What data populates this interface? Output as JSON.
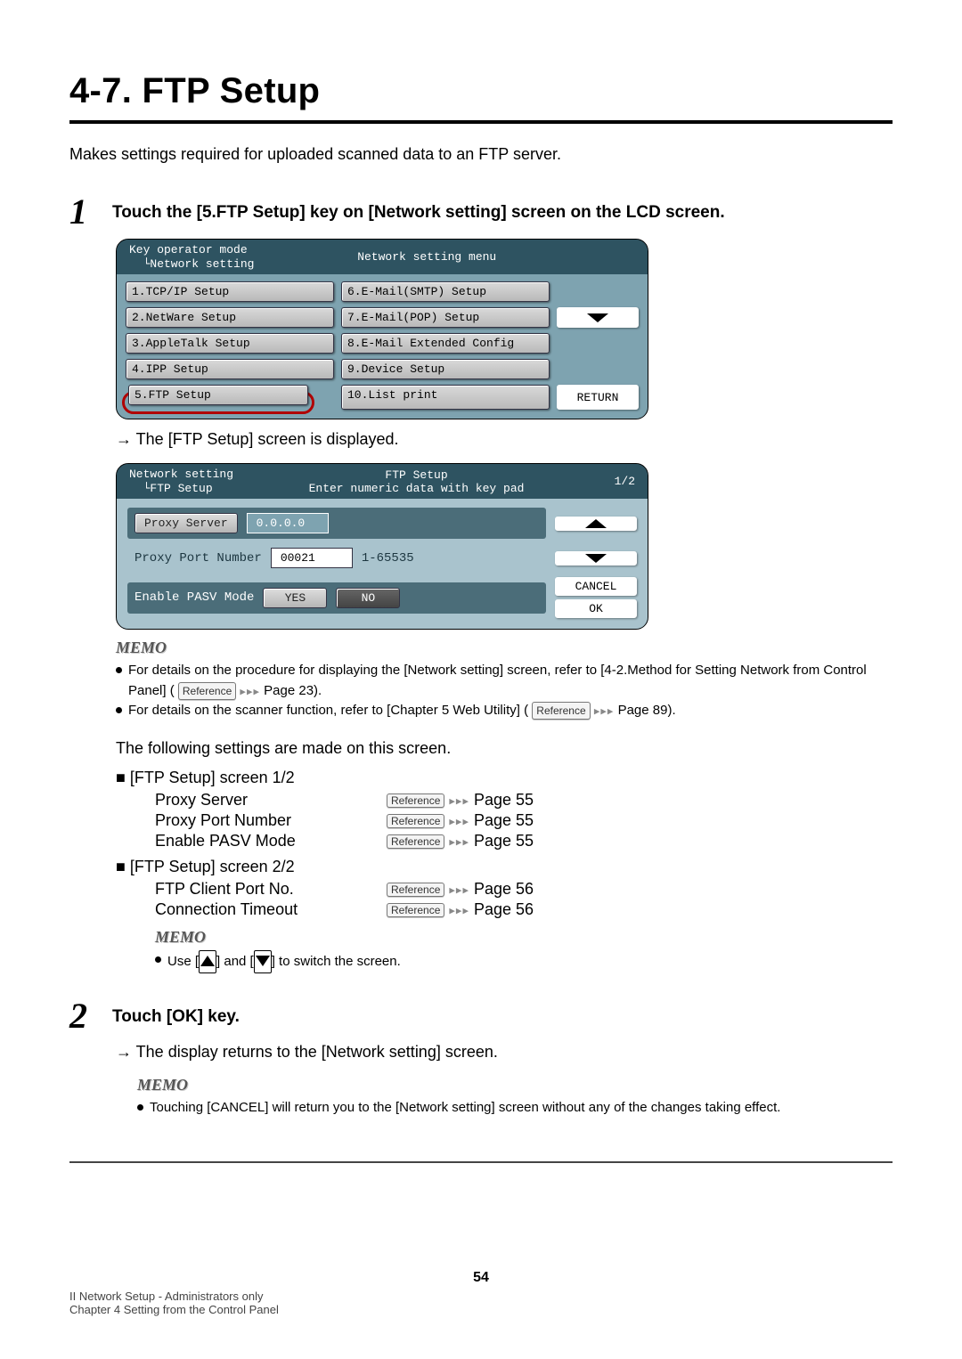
{
  "title": "4-7. FTP Setup",
  "intro": "Makes settings required for uploaded scanned data to an FTP server.",
  "step1_title": "Touch the [5.FTP Setup] key on [Network setting] screen on the LCD screen.",
  "arrow1": "→ The [FTP Setup] screen is displayed.",
  "lcd1": {
    "top_left": "Key operator mode\n  └Network setting",
    "top_center": "Network setting menu",
    "items_left": [
      "1.TCP/IP Setup",
      "2.NetWare Setup",
      "3.AppleTalk Setup",
      "4.IPP Setup",
      "5.FTP Setup"
    ],
    "items_right": [
      "6.E-Mail(SMTP) Setup",
      "7.E-Mail(POP) Setup",
      "8.E-Mail Extended Config",
      "9.Device Setup",
      "10.List print"
    ],
    "return": "RETURN"
  },
  "lcd2": {
    "top_left": "Network setting\n  └FTP Setup",
    "top_center": "FTP Setup\nEnter numeric data with key pad",
    "page": "1/2",
    "proxy_server_label": "Proxy Server",
    "proxy_server_value": "0.0.0.0",
    "proxy_port_label": "Proxy Port Number",
    "proxy_port_value": "00021",
    "proxy_port_hint": "1-65535",
    "pasv_label": "Enable PASV Mode",
    "yes": "YES",
    "no": "NO",
    "cancel": "CANCEL",
    "ok": "OK"
  },
  "memo": "MEMO",
  "memo1_lines": [
    "For details on the procedure for displaying the [Network setting] screen, refer to [4-2.Method for Setting Network from Control Panel] ( ",
    " Page 23).",
    "For details on the scanner function, refer to [Chapter 5 Web Utility] ( ",
    " Page 89)."
  ],
  "ref_label": "Reference",
  "ref_dots": "▸▸▸",
  "following": "The following settings are made on this screen.",
  "sec1_head": "[FTP Setup] screen 1/2",
  "sec1_rows": [
    {
      "name": "Proxy Server",
      "page": "Page 55"
    },
    {
      "name": "Proxy Port Number",
      "page": "Page 55"
    },
    {
      "name": "Enable PASV Mode",
      "page": "Page 55"
    }
  ],
  "sec2_head": "[FTP Setup] screen 2/2",
  "sec2_rows": [
    {
      "name": "FTP Client Port No.",
      "page": "Page 56"
    },
    {
      "name": "Connection Timeout",
      "page": "Page 56"
    }
  ],
  "memo2_pre": "Use [",
  "memo2_mid": "] and [",
  "memo2_post": "] to switch the screen.",
  "step2_title": "Touch [OK] key.",
  "arrow2": "→ The display returns to the [Network setting] screen.",
  "memo3": "Touching [CANCEL] will return you to the [Network setting] screen without any of the changes taking effect.",
  "footer_left1": "II Network Setup - Administrators only",
  "footer_left2": "Chapter 4 Setting from the Control Panel",
  "page_number": "54"
}
